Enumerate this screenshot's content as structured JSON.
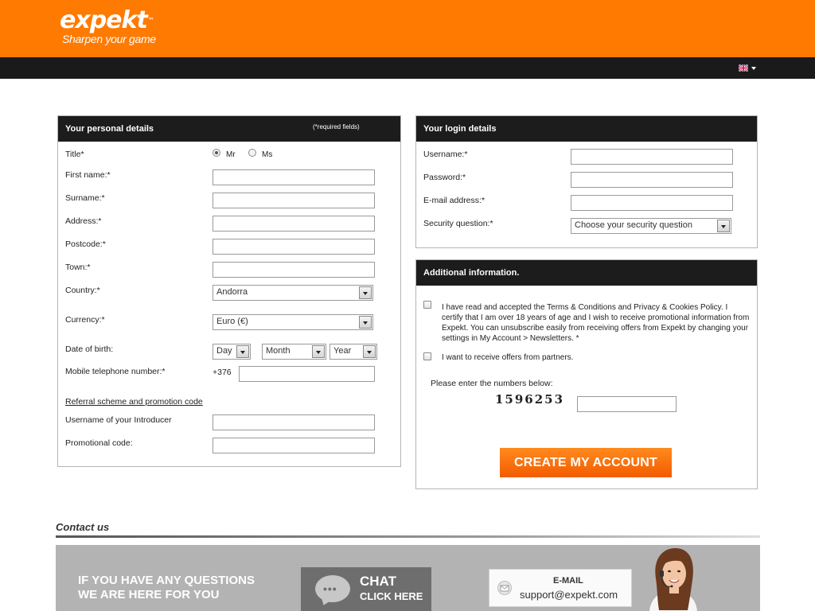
{
  "header": {
    "logo_text": "expekt",
    "logo_tm": "™",
    "tagline": "Sharpen your game",
    "language": "en-GB",
    "brand_color": "#ff7a00"
  },
  "personal": {
    "heading": "Your personal details",
    "required_note": "(*required fields)",
    "title_label": "Title*",
    "title_options": [
      "Mr",
      "Ms"
    ],
    "title_selected": "Mr",
    "first_name_label": "First name:*",
    "surname_label": "Surname:*",
    "address_label": "Address:*",
    "postcode_label": "Postcode:*",
    "town_label": "Town:*",
    "country_label": "Country:*",
    "country_value": "Andorra",
    "currency_label": "Currency:*",
    "currency_value": "Euro (€)",
    "dob_label": "Date of birth:",
    "dob_day": "Day",
    "dob_month": "Month",
    "dob_year": "Year",
    "mobile_label": "Mobile telephone number:*",
    "mobile_prefix": "+376",
    "referral_link": "Referral scheme and promotion code",
    "introducer_label": "Username of your Introducer",
    "promo_label": "Promotional code:"
  },
  "login": {
    "heading": "Your login details",
    "username_label": "Username:*",
    "password_label": "Password:*",
    "email_label": "E-mail address:*",
    "security_label": "Security question:*",
    "security_value": "Choose your security question"
  },
  "additional": {
    "heading": "Additional information.",
    "terms_pre": "I have read and accepted the ",
    "terms_link": "Terms & Conditions",
    "terms_mid": " and ",
    "privacy_link": "Privacy & Cookies Policy",
    "terms_post": ". I certify that I am over 18 years of age and I wish to receive promotional information from Expekt. You can unsubscribe easily from receiving offers from Expekt by changing your settings in My Account > Newsletters. *",
    "partners_text": "I want to receive offers from partners.",
    "captcha_prompt": "Please enter the numbers below:",
    "captcha_code": "1596253",
    "submit_label": "CREATE MY ACCOUNT"
  },
  "contact": {
    "title": "Contact us",
    "question_line1": "IF YOU HAVE ANY QUESTIONS",
    "question_line2": "WE ARE HERE FOR YOU",
    "chat_line1": "CHAT",
    "chat_line2": "CLICK HERE",
    "chat_dots": "•••",
    "email_title": "E-MAIL",
    "email_address": "support@expekt.com"
  }
}
